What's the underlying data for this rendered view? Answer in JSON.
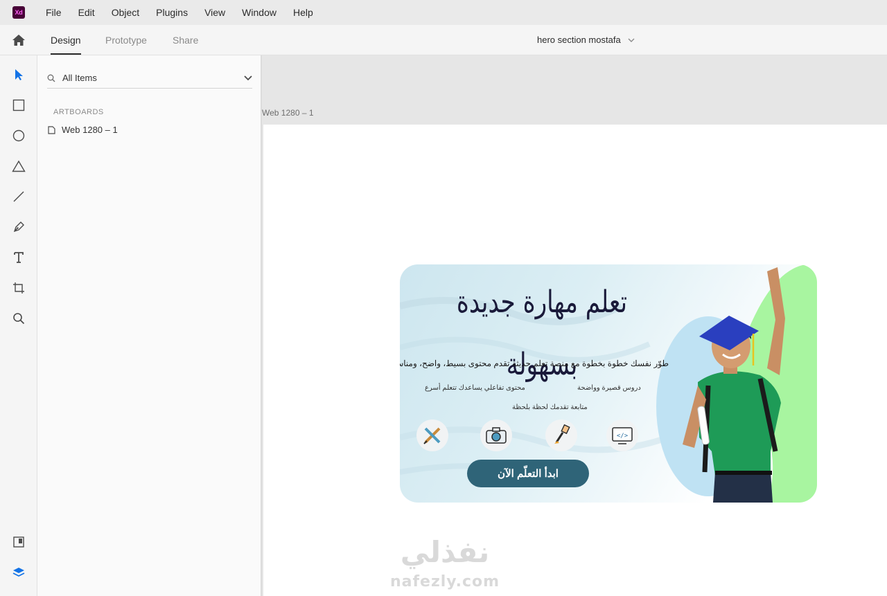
{
  "app": {
    "logo_text": "Xd",
    "menu": [
      "File",
      "Edit",
      "Object",
      "Plugins",
      "View",
      "Window",
      "Help"
    ]
  },
  "tabs": {
    "design": "Design",
    "prototype": "Prototype",
    "share": "Share"
  },
  "document": {
    "title": "hero section mostafa"
  },
  "layers_panel": {
    "search_text": "All Items",
    "section_label": "ARTBOARDS",
    "artboards": [
      "Web 1280 – 1"
    ]
  },
  "canvas": {
    "artboard_label": "Web 1280 – 1",
    "hero": {
      "title": "تعلم مهارة جديدة بسهولة",
      "description": "طوّر نفسك خطوة بخطوة مع منصة تعلم حديثة تقدم محتوى بسيط، واضح، ومناسب لكل مستوى، إلى اللي تحتاجه إنك تبدأ",
      "feature_1": "دروس قصيرة وواضحة",
      "feature_2": "محتوى تفاعلي يساعدك تتعلم أسرع",
      "feature_3": "متابعة تقدمك لحظة بلحظة",
      "cta": "ابدأ التعلّم الآن"
    }
  },
  "watermark": {
    "arabic": "نفذلي",
    "latin": "nafezly.com"
  },
  "colors": {
    "accent_tool": "#1473e6",
    "cta_bg": "#2f6478",
    "shirt_green": "#1e9b57",
    "blob_green": "#a8f5a0"
  }
}
